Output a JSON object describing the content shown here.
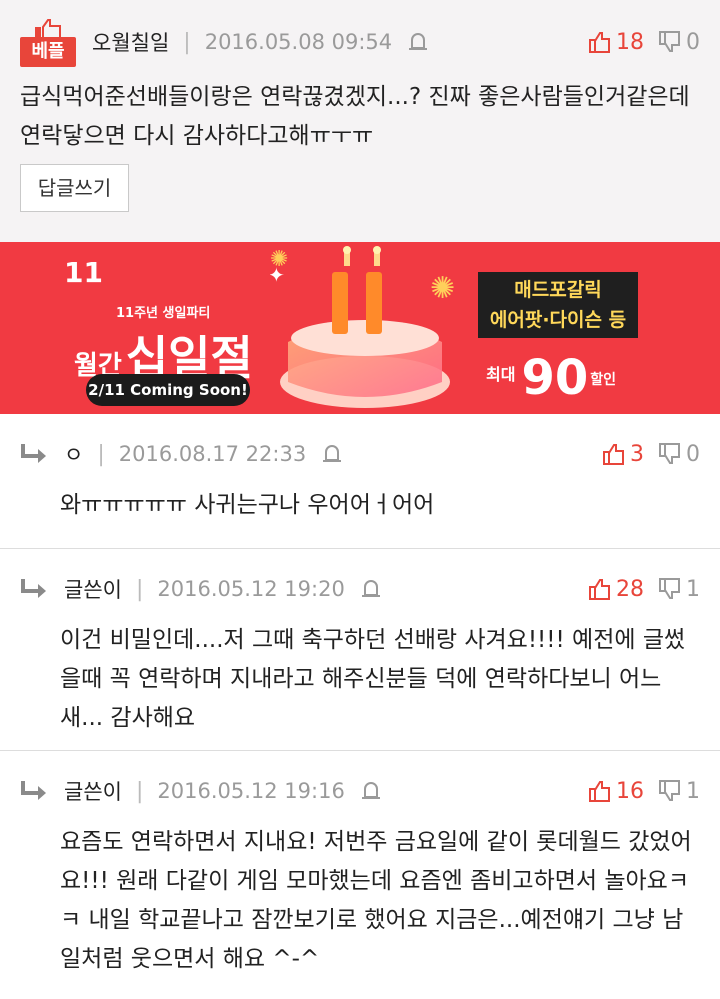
{
  "best_comment": {
    "badge": "베플",
    "author": "오월칠일",
    "date": "2016.05.08 09:54",
    "upvotes": "18",
    "downvotes": "0",
    "body": "급식먹어준선배들이랑은 연락끊겼겠지...? 진짜 좋은사람들인거같은데 연락닿으면 다시 감사하다고해ㅠㅜㅠ",
    "reply_button": "답글쓰기"
  },
  "ad": {
    "logo": "11",
    "subtitle": "11주년 생일파티",
    "title_small": "월간",
    "title_big": "십일절",
    "pill": "2/11 Coming Soon!",
    "promo_line1": "매드포갈릭",
    "promo_line2": "에어팟·다이슨 등",
    "discount_prefix": "최대",
    "discount_value": "90",
    "discount_suffix": "할인"
  },
  "replies": [
    {
      "author": "ㅇ",
      "date": "2016.08.17 22:33",
      "upvotes": "3",
      "downvotes": "0",
      "body": "와ㅠㅠㅠㅠㅠ 사귀는구나 우어어ㅓ어어"
    },
    {
      "author": "글쓴이",
      "date": "2016.05.12 19:20",
      "upvotes": "28",
      "downvotes": "1",
      "body": "이건 비밀인데....저 그때 축구하던 선배랑 사겨요!!!! 예전에 글썼을때 꼭 연락하며 지내라고 해주신분들 덕에 연락하다보니 어느새... 감사해요"
    },
    {
      "author": "글쓴이",
      "date": "2016.05.12 19:16",
      "upvotes": "16",
      "downvotes": "1",
      "body": "요즘도 연락하면서 지내요! 저번주 금요일에 같이 롯데월드 갔었어요!!! 원래 다같이 게임 모마했는데 요즘엔 좀비고하면서 놀아요ㅋㅋ 내일 학교끝나고 잠깐보기로 했어요 지금은...예전얘기 그냥 남일처럼 웃으면서 해요 ^-^"
    }
  ],
  "colors": {
    "accent": "#e8453a",
    "ad_background": "#f13a42",
    "muted": "#9a9a9a"
  }
}
